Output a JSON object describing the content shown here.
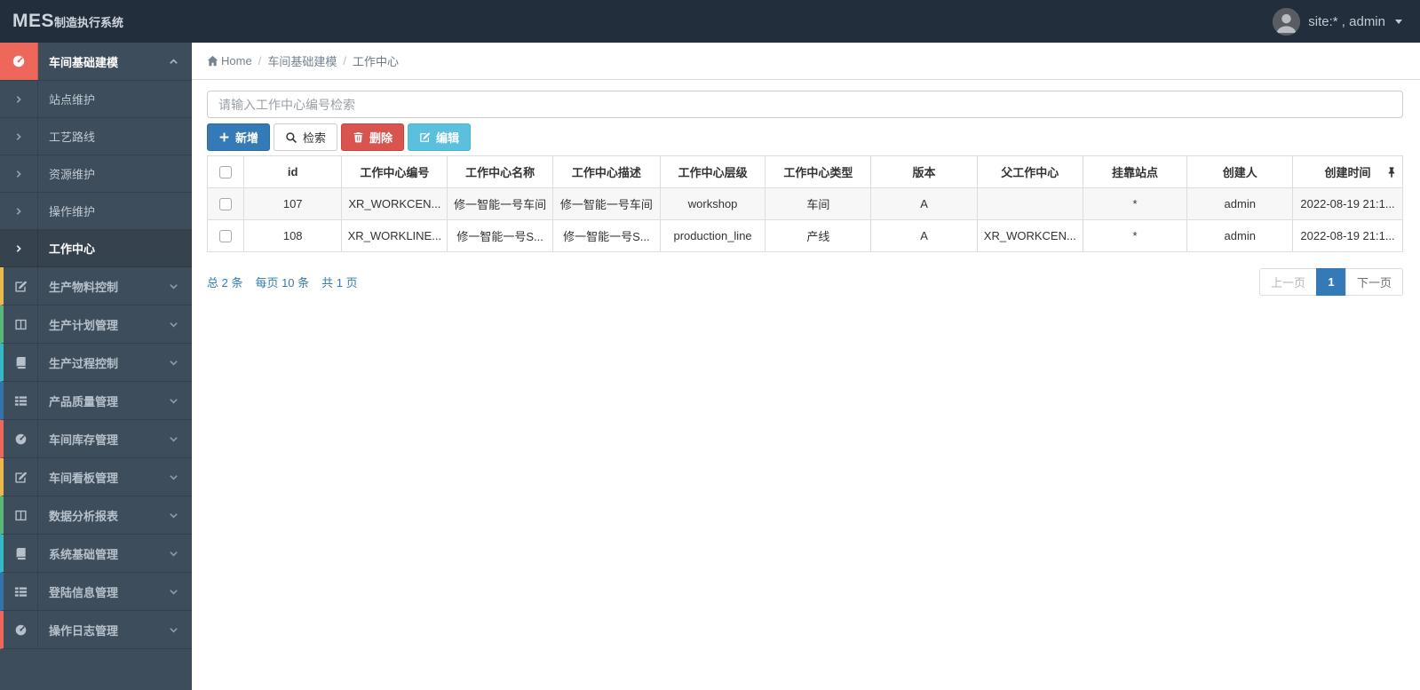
{
  "app": {
    "brand_bold": "MES",
    "brand_rest": "制造执行系统",
    "user_label": "site:* , admin"
  },
  "colors": {
    "topbar_bg": "#232e3c",
    "sidebar_bg": "#3e4d5c",
    "accent_red": "#ed685a",
    "accent_yellow": "#e9b84e",
    "accent_green": "#5cb87a",
    "accent_teal": "#35b9c6",
    "accent_blue": "#3472a8",
    "btn_primary": "#337ab7",
    "btn_danger": "#d9534f",
    "btn_info": "#5bc0de",
    "link_blue": "#337ab7"
  },
  "sidebar": {
    "groups": [
      {
        "label": "车间基础建模",
        "icon": "dashboard-icon",
        "accent": "#ed685a",
        "expanded": true,
        "children": [
          {
            "label": "站点维护"
          },
          {
            "label": "工艺路线"
          },
          {
            "label": "资源维护"
          },
          {
            "label": "操作维护"
          },
          {
            "label": "工作中心",
            "active": true
          }
        ]
      },
      {
        "label": "生产物料控制",
        "icon": "edit-icon",
        "accent": "#e9b84e"
      },
      {
        "label": "生产计划管理",
        "icon": "columns-icon",
        "accent": "#5cb87a"
      },
      {
        "label": "生产过程控制",
        "icon": "book-icon",
        "accent": "#35b9c6"
      },
      {
        "label": "产品质量管理",
        "icon": "list-icon",
        "accent": "#3472a8"
      },
      {
        "label": "车间库存管理",
        "icon": "dashboard-icon",
        "accent": "#ed685a"
      },
      {
        "label": "车间看板管理",
        "icon": "edit-icon",
        "accent": "#e9b84e"
      },
      {
        "label": "数据分析报表",
        "icon": "columns-icon",
        "accent": "#5cb87a"
      },
      {
        "label": "系统基础管理",
        "icon": "book-icon",
        "accent": "#35b9c6"
      },
      {
        "label": "登陆信息管理",
        "icon": "list-icon",
        "accent": "#3472a8"
      },
      {
        "label": "操作日志管理",
        "icon": "dashboard-icon",
        "accent": "#ed685a"
      }
    ]
  },
  "breadcrumb": {
    "home": "Home",
    "section": "车间基础建模",
    "current": "工作中心"
  },
  "search": {
    "placeholder": "请输入工作中心编号检索",
    "value": ""
  },
  "toolbar": {
    "add_label": "新增",
    "search_label": "检索",
    "delete_label": "删除",
    "edit_label": "编辑"
  },
  "table": {
    "columns": [
      "id",
      "工作中心编号",
      "工作中心名称",
      "工作中心描述",
      "工作中心层级",
      "工作中心类型",
      "版本",
      "父工作中心",
      "挂靠站点",
      "创建人",
      "创建时间"
    ],
    "rows": [
      {
        "id": "107",
        "code": "XR_WORKCEN...",
        "name": "修一智能一号车间",
        "desc": "修一智能一号车间",
        "level": "workshop",
        "type": "车间",
        "version": "A",
        "parent": "",
        "station": "*",
        "creator": "admin",
        "created": "2022-08-19 21:1..."
      },
      {
        "id": "108",
        "code": "XR_WORKLINE...",
        "name": "修一智能一号S...",
        "desc": "修一智能一号S...",
        "level": "production_line",
        "type": "产线",
        "version": "A",
        "parent": "XR_WORKCEN...",
        "station": "*",
        "creator": "admin",
        "created": "2022-08-19 21:1..."
      }
    ]
  },
  "pagination": {
    "summary_total": "总 2 条",
    "summary_per_page": "每页 10 条",
    "summary_pages": "共 1 页",
    "prev_label": "上一页",
    "current_page": "1",
    "next_label": "下一页"
  }
}
